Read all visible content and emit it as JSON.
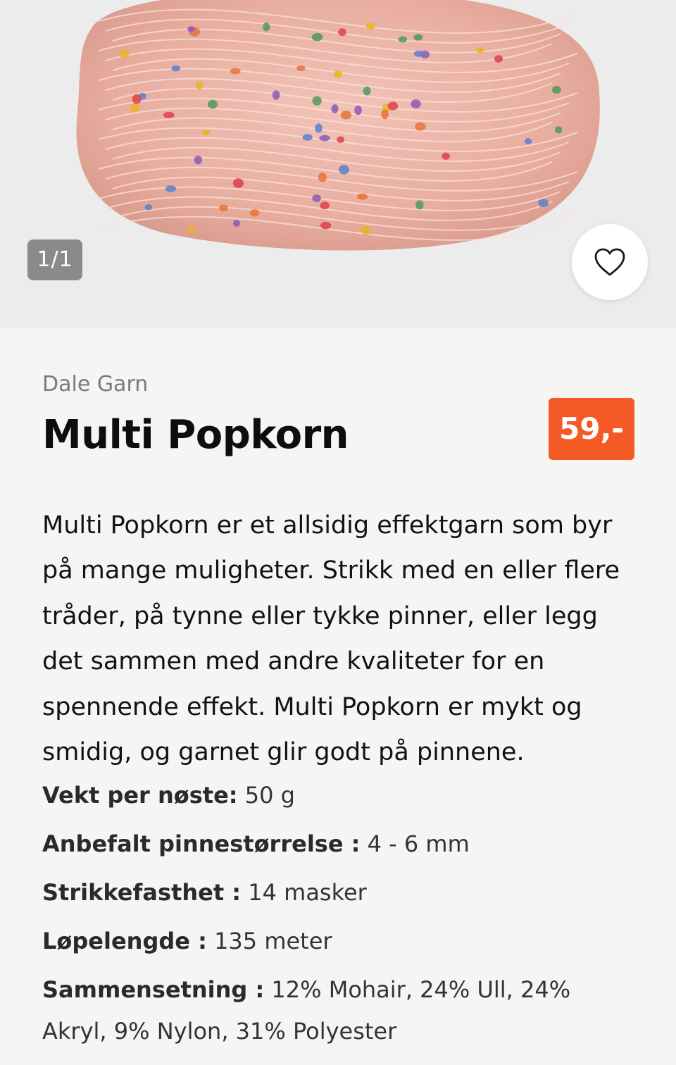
{
  "gallery": {
    "counter": "1/1",
    "favorite_icon": "heart-outline-icon"
  },
  "product": {
    "brand": "Dale Garn",
    "title": "Multi Popkorn",
    "price": "59,-",
    "description": "Multi Popkorn er et allsidig effektgarn som byr på mange muligheter. Strikk med en eller flere tråder, på tynne eller tykke pinner, eller legg det sammen med andre kvaliteter for en spennende effekt. Multi Popkorn er mykt og smidig, og garnet glir godt på pinnene."
  },
  "specs": [
    {
      "label": "Vekt per nøste:",
      "value": " 50 g"
    },
    {
      "label": "Anbefalt pinnestørrelse :",
      "value": " 4 - 6 mm"
    },
    {
      "label": "Strikkefasthet :",
      "value": " 14 masker"
    },
    {
      "label": "Løpelengde :",
      "value": " 135 meter"
    },
    {
      "label": "Sammensetning :",
      "value": " 12% Mohair, 24% Ull, 24% Akryl, 9% Nylon, 31% Polyester"
    }
  ],
  "colors": {
    "price_badge": "#f45a25",
    "yarn_pink": "#eab1a5",
    "background": "#f6f5f3"
  }
}
